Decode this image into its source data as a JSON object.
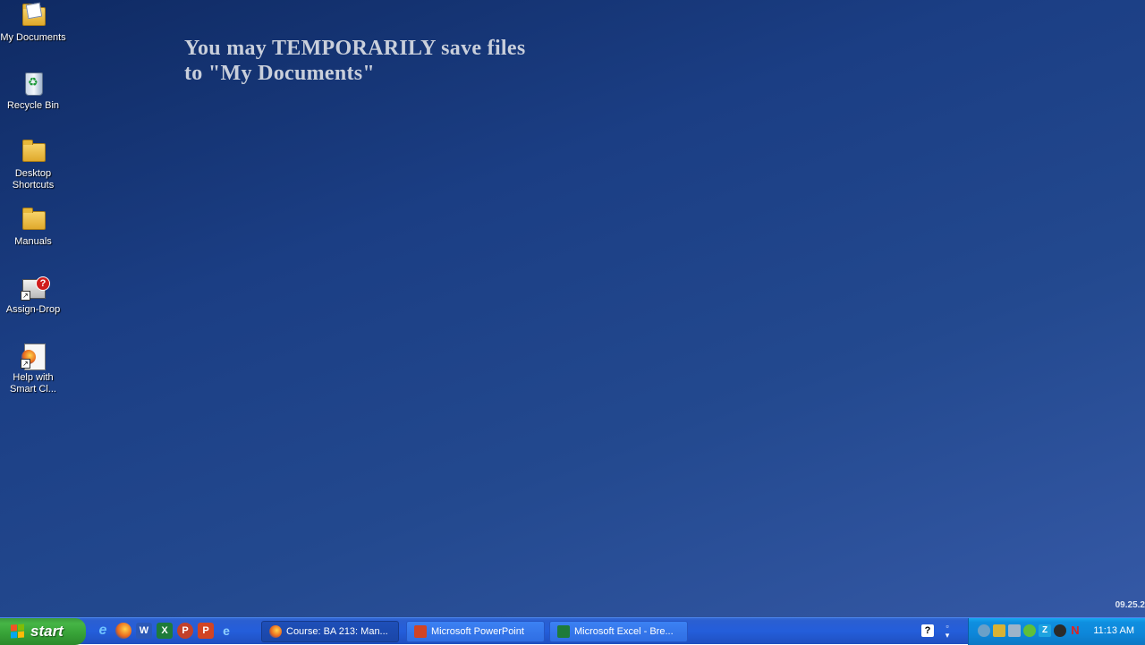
{
  "desktop": {
    "banner_line1": "You may TEMPORARILY save files",
    "banner_line2": "to \"My Documents\"",
    "date_stamp": "09.25.2",
    "icons": [
      {
        "label": "My Documents"
      },
      {
        "label": "Recycle Bin"
      },
      {
        "label_line1": "Desktop",
        "label_line2": "Shortcuts"
      },
      {
        "label": "Manuals"
      },
      {
        "label": "Assign-Drop"
      },
      {
        "label_line1": "Help with",
        "label_line2": "Smart Cl..."
      }
    ]
  },
  "taskbar": {
    "start_label": "start",
    "quick_launch": [
      "internet-explorer-icon",
      "firefox-icon",
      "word-icon",
      "excel-icon",
      "publisher-icon",
      "powerpoint-icon",
      "ie-icon"
    ],
    "tasks": [
      {
        "label": "Course: BA 213: Man...",
        "app": "firefox",
        "active": true
      },
      {
        "label": "Microsoft PowerPoint",
        "app": "powerpoint",
        "active": false
      },
      {
        "label": "Microsoft Excel - Bre...",
        "app": "excel",
        "active": false
      }
    ],
    "tray_help": "?",
    "clock": "11:13 AM"
  },
  "colors": {
    "desktop_bg": "#1b3e84",
    "taskbar": "#245edb",
    "start_button": "#3c9a3c",
    "tray": "#0f8fe0"
  }
}
